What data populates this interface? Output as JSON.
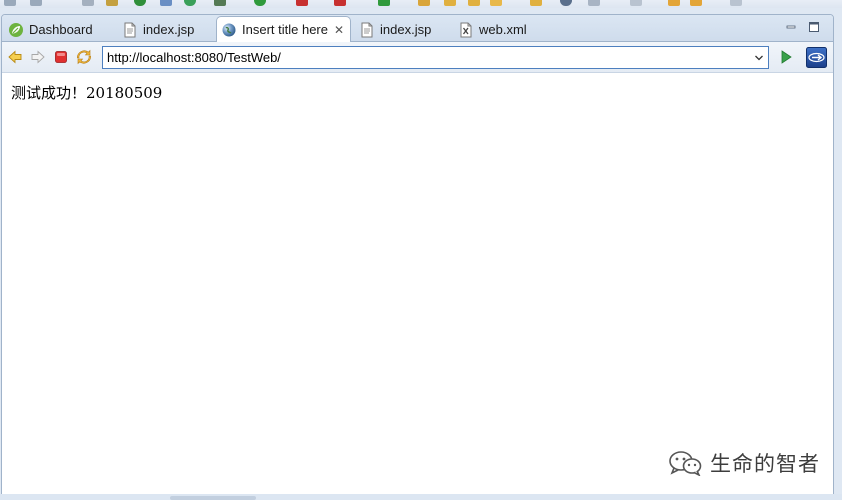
{
  "tabs": [
    {
      "label": "Dashboard",
      "icon": "spring-leaf-icon",
      "active": false
    },
    {
      "label": "index.jsp",
      "icon": "jsp-file-icon",
      "active": false
    },
    {
      "label": "Insert title here",
      "icon": "globe-icon",
      "active": true,
      "close_glyph": "✕"
    },
    {
      "label": "index.jsp",
      "icon": "jsp-file-icon",
      "active": false
    },
    {
      "label": "web.xml",
      "icon": "xml-file-icon",
      "active": false
    }
  ],
  "browser": {
    "url": "http://localhost:8080/TestWeb/"
  },
  "page": {
    "body_text": "测试成功！20180509"
  },
  "watermark": {
    "text": "生命的智者"
  },
  "colors": {
    "frame_border": "#a0b3ca",
    "url_border": "#4d7fbf",
    "chrome_bg": "#dfe8f3"
  }
}
